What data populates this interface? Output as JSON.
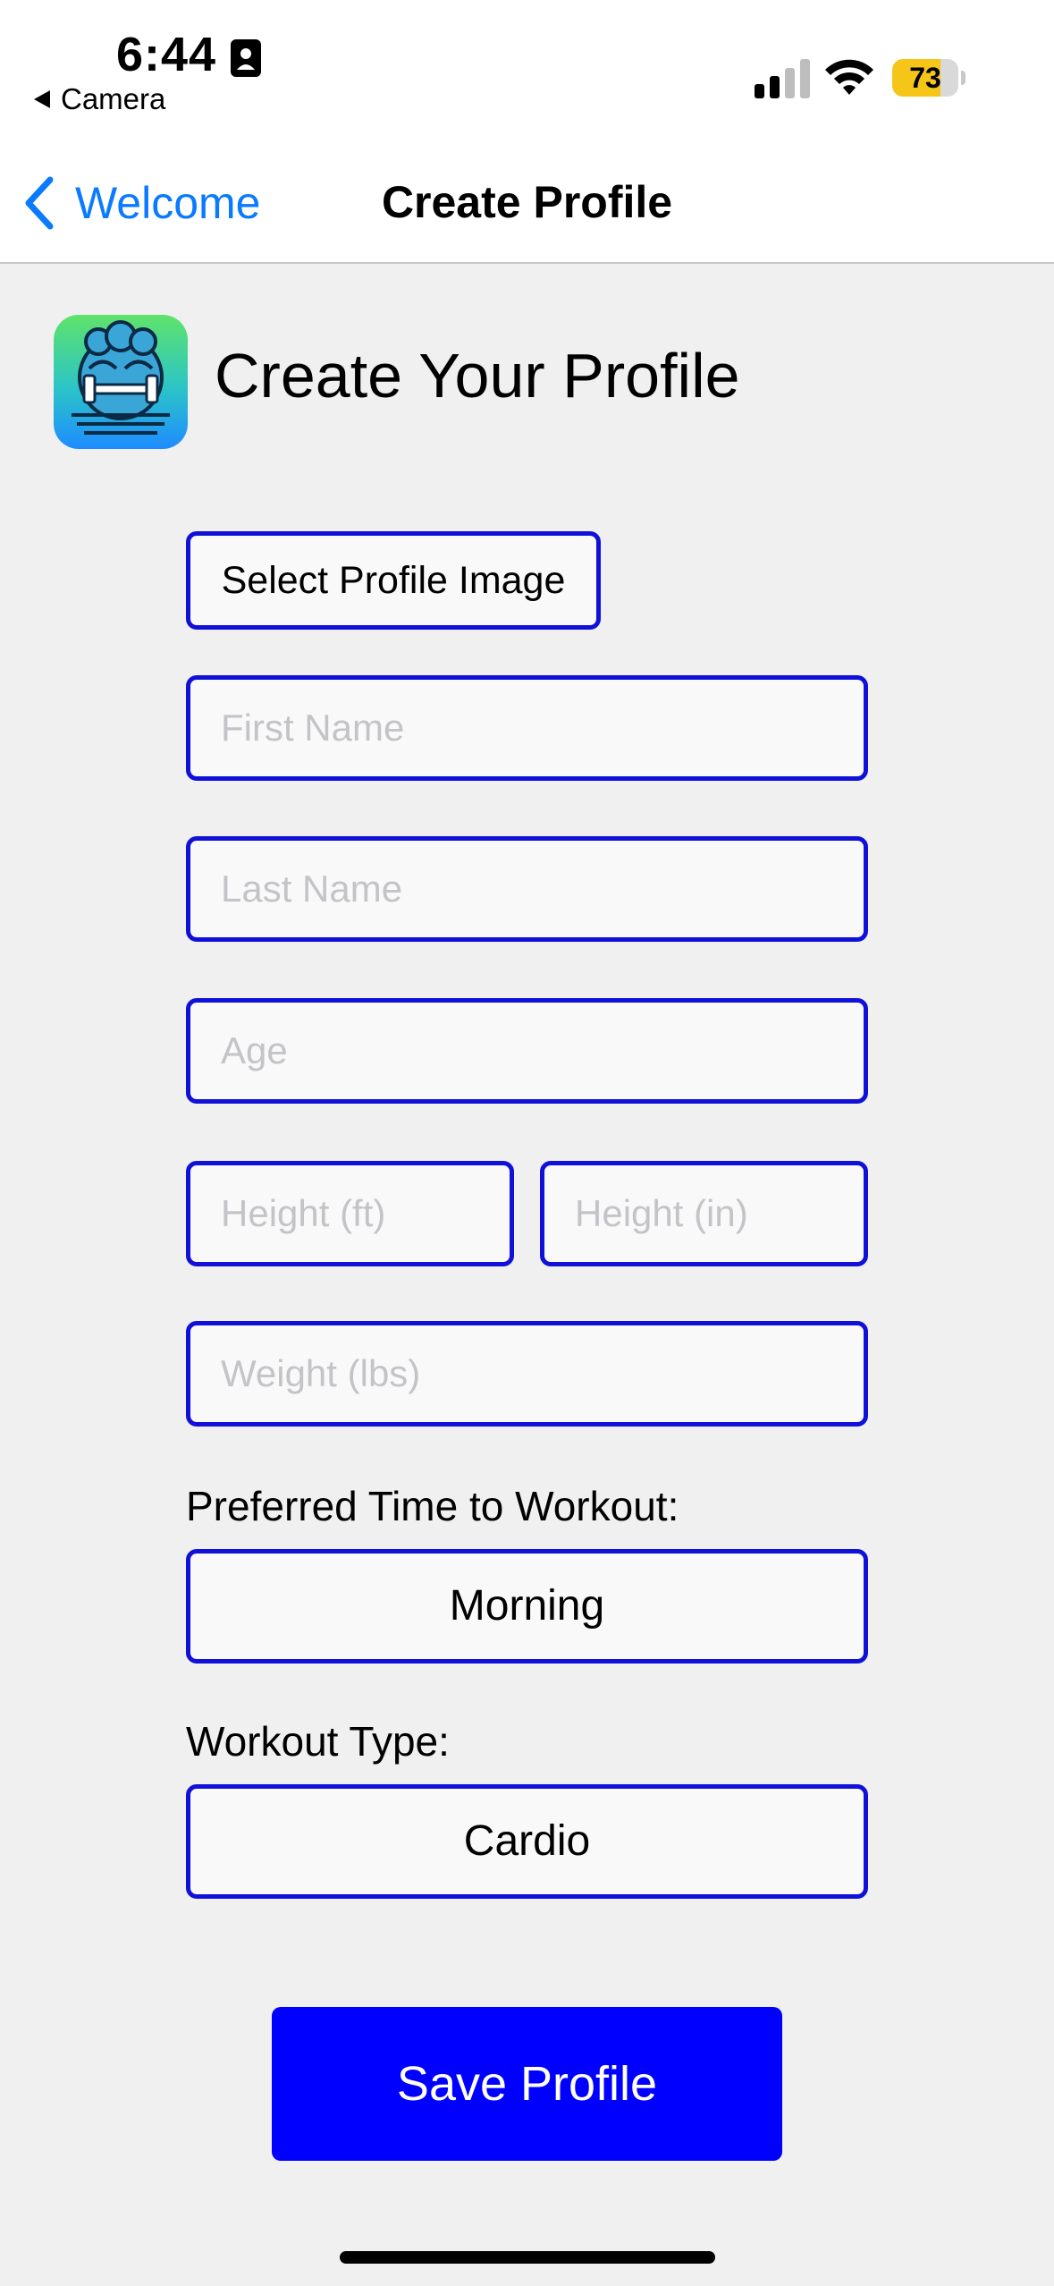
{
  "status_bar": {
    "time": "6:44",
    "back_app": "Camera",
    "battery_level": "73",
    "battery_fraction": 0.73,
    "battery_color": "#f5c518"
  },
  "nav": {
    "back_label": "Welcome",
    "title": "Create Profile",
    "tint": "#0a7aff"
  },
  "header": {
    "title": "Create Your Profile",
    "app_icon": "fitness-brain-dumbbell-icon"
  },
  "form": {
    "select_image_label": "Select Profile Image",
    "first_name": {
      "placeholder": "First Name",
      "value": ""
    },
    "last_name": {
      "placeholder": "Last Name",
      "value": ""
    },
    "age": {
      "placeholder": "Age",
      "value": ""
    },
    "height_ft": {
      "placeholder": "Height (ft)",
      "value": ""
    },
    "height_in": {
      "placeholder": "Height (in)",
      "value": ""
    },
    "weight": {
      "placeholder": "Weight (lbs)",
      "value": ""
    },
    "workout_time_label": "Preferred Time to Workout:",
    "workout_time_value": "Morning",
    "workout_type_label": "Workout Type:",
    "workout_type_value": "Cardio",
    "border_color": "#1010d8"
  },
  "save_button": {
    "label": "Save Profile",
    "color": "#0000ff"
  }
}
